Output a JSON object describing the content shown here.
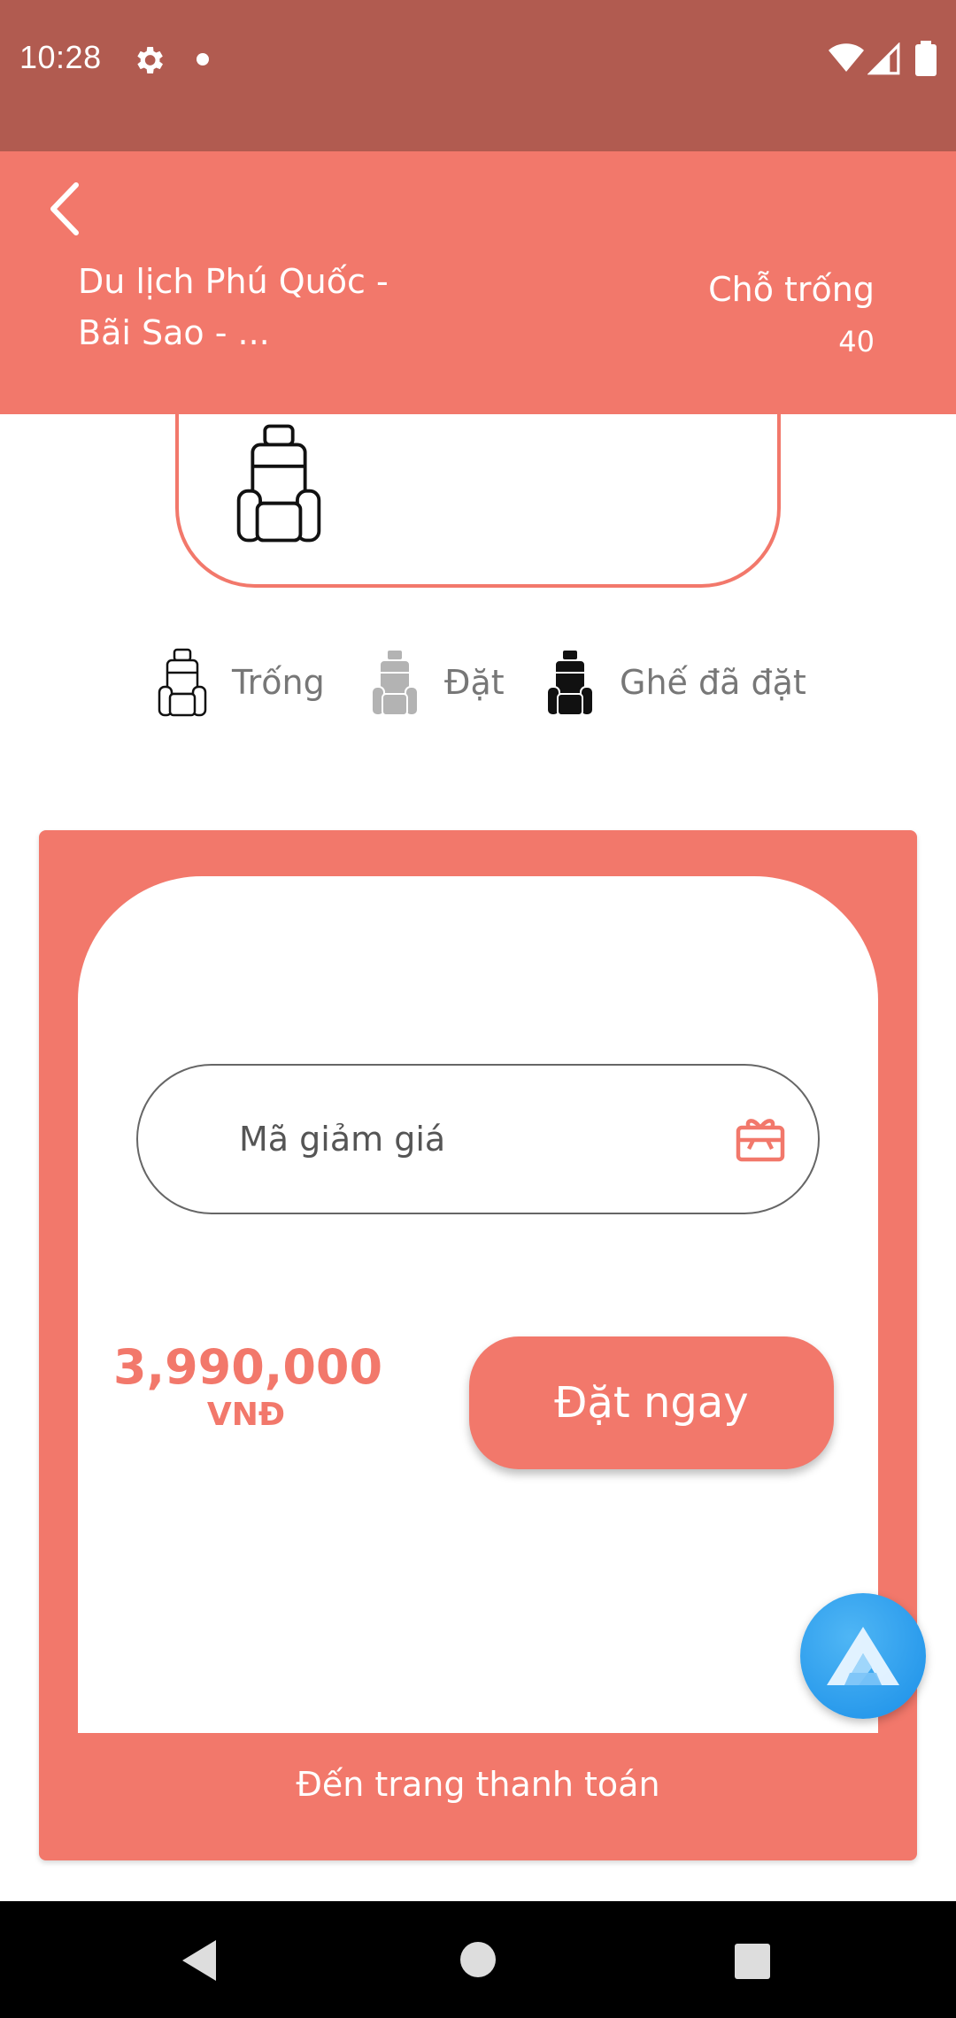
{
  "status_bar": {
    "time": "10:28",
    "icons": [
      "gear-icon",
      "notification-dot-icon",
      "wifi-icon",
      "signal-icon",
      "battery-icon"
    ]
  },
  "header": {
    "back_icon": "chevron-left-icon",
    "title": "Du lịch Phú Quốc - Bãi Sao - ...",
    "seats_label": "Chỗ trống",
    "seats_count": "40"
  },
  "legend": {
    "items": [
      {
        "label": "Trống",
        "icon": "seat-outline-icon"
      },
      {
        "label": "Đặt",
        "icon": "seat-grey-icon"
      },
      {
        "label": "Ghế đã đặt",
        "icon": "seat-black-icon"
      }
    ]
  },
  "booking": {
    "coupon_placeholder": "Mã giảm giá",
    "coupon_icon": "gift-card-icon",
    "price_value": "3,990,000",
    "price_unit": "VNĐ",
    "book_button": "Đặt ngay",
    "checkout_link": "Đến trang thanh toán"
  },
  "colors": {
    "primary": "#f2786b",
    "status_bar": "#b15b50",
    "fab": "#1a8fe8"
  },
  "nav": {
    "icons": [
      "nav-back-icon",
      "nav-home-icon",
      "nav-recent-icon"
    ]
  }
}
